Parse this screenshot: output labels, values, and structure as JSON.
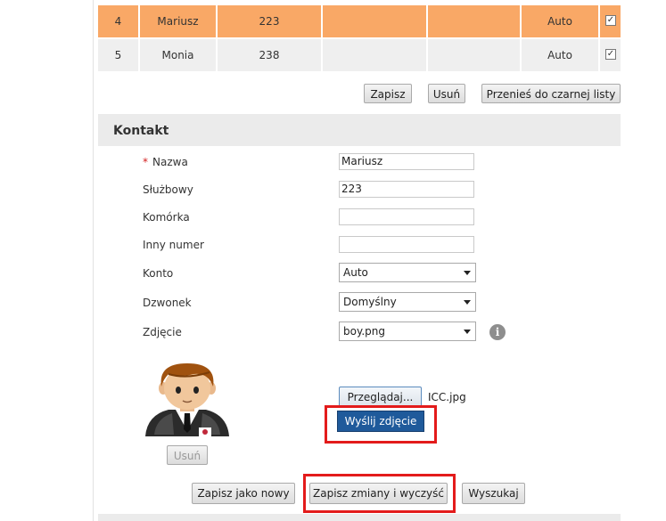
{
  "table": {
    "rows": [
      {
        "id": "4",
        "name": "Mariusz",
        "number": "223",
        "col4": "",
        "col5": "",
        "account": "Auto",
        "checked": "✓"
      },
      {
        "id": "5",
        "name": "Monia",
        "number": "238",
        "col4": "",
        "col5": "",
        "account": "Auto",
        "checked": "✓"
      }
    ],
    "highlight_color": "#f9a866"
  },
  "table_actions": {
    "save": "Zapisz",
    "delete": "Usuń",
    "move_blacklist": "Przenieś do czarnej listy"
  },
  "contact": {
    "section_title": "Kontakt",
    "required_mark": "*",
    "fields": {
      "name": {
        "label": "Nazwa",
        "value": "Mariusz"
      },
      "work": {
        "label": "Służbowy",
        "value": "223"
      },
      "mobile": {
        "label": "Komórka",
        "value": ""
      },
      "other": {
        "label": "Inny numer",
        "value": ""
      },
      "account": {
        "label": "Konto",
        "value": "Auto"
      },
      "ringtone": {
        "label": "Dzwonek",
        "value": "Domyślny"
      },
      "photo": {
        "label": "Zdjęcie",
        "value": "boy.png"
      }
    },
    "info_icon": "i",
    "avatar_delete": "Usuń",
    "browse": "Przeglądaj...",
    "selected_file": "ICC.jpg",
    "upload": "Wyślij zdjęcie"
  },
  "footer_actions": {
    "save_new": "Zapisz jako nowy",
    "save_clear": "Zapisz zmiany i wyczyść",
    "search": "Wyszukaj"
  },
  "colors": {
    "accent_blue": "#1f5a9b",
    "annotation_red": "#e31b1b"
  }
}
